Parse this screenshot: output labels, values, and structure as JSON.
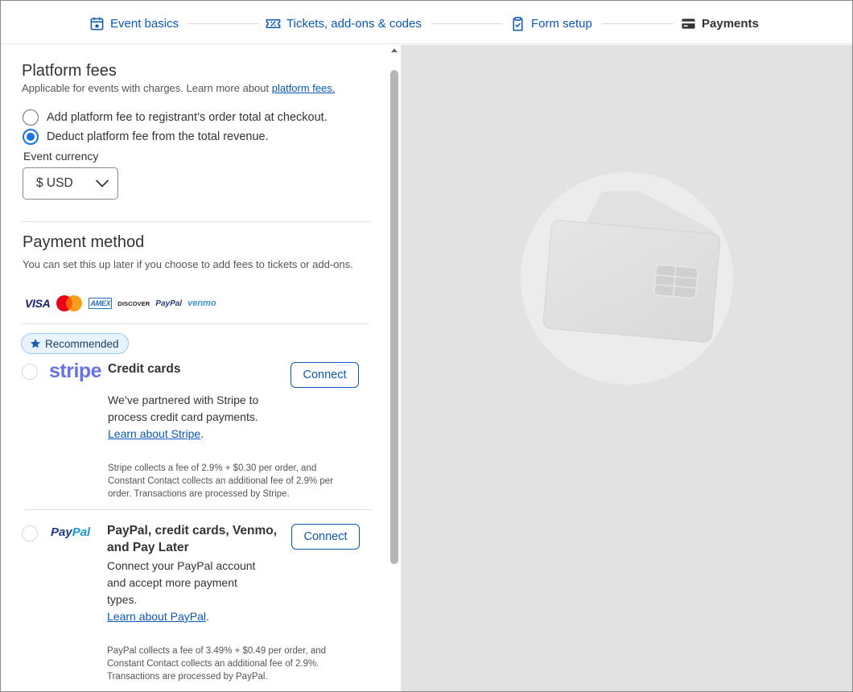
{
  "stepper": {
    "steps": [
      {
        "label": "Event basics",
        "icon": "calendar-star-icon"
      },
      {
        "label": "Tickets, add-ons & codes",
        "icon": "ticket-icon"
      },
      {
        "label": "Form setup",
        "icon": "clipboard-check-icon"
      },
      {
        "label": "Payments",
        "icon": "card-icon",
        "active": true
      }
    ]
  },
  "platform_fees": {
    "title": "Platform fees",
    "subtitle_prefix": "Applicable for events with charges. Learn more about ",
    "subtitle_link": "platform fees.",
    "options": [
      {
        "label": "Add platform fee to registrant’s order total at checkout.",
        "selected": false
      },
      {
        "label": "Deduct platform fee from the total revenue.",
        "selected": true
      }
    ],
    "currency_label": "Event currency",
    "currency_value": "$ USD"
  },
  "payment_method": {
    "title": "Payment method",
    "subtitle": "You can set this up later if you choose to add fees to tickets or add-ons.",
    "card_logos": [
      "VISA",
      "MASTERCARD",
      "AMEX",
      "DISCOVER",
      "PayPal",
      "venmo"
    ],
    "badge": "Recommended",
    "stripe": {
      "logo": "stripe",
      "title": "Credit cards",
      "button": "Connect",
      "desc_lines": [
        "We’ve partnered with Stripe to",
        "process credit card payments."
      ],
      "link": "Learn about Stripe",
      "link_suffix": ".",
      "fine_lines": [
        "Stripe collects a fee of 2.9% + $0.30 per order, and",
        "Constant Contact collects an additional fee of 2.9% per",
        "order. Transactions are processed by Stripe."
      ]
    },
    "paypal": {
      "logo_a": "Pay",
      "logo_b": "Pal",
      "title_lines": [
        "PayPal, credit cards, Venmo,",
        "and Pay Later"
      ],
      "button": "Connect",
      "desc_lines": [
        "Connect your PayPal account",
        "and accept more payment",
        "types."
      ],
      "link": "Learn about PayPal",
      "link_suffix": ".",
      "fine_lines": [
        "PayPal collects a fee of 3.49% + $0.49 per order, and",
        "Constant Contact collects an additional fee of 2.9%.",
        "Transactions are processed by PayPal."
      ]
    }
  },
  "colors": {
    "accent": "#0a58b5",
    "radio": "#1a73e8",
    "preview_bg": "#e2e2e2",
    "stripe": "#6772e5"
  }
}
